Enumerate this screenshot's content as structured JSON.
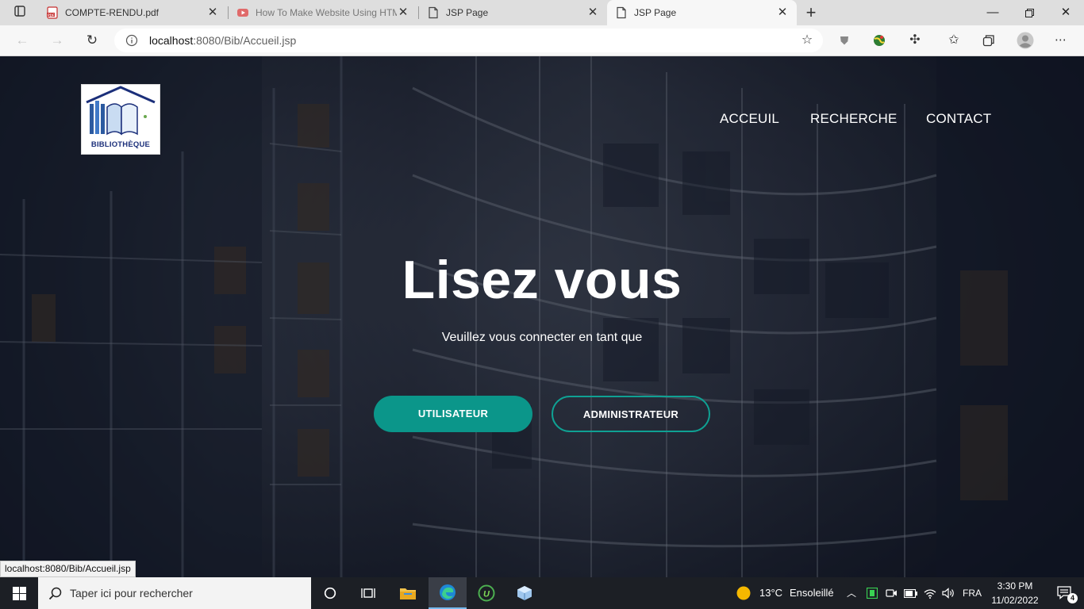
{
  "browser": {
    "tabs": [
      {
        "title": "COMPTE-RENDU.pdf",
        "icon": "pdf-icon",
        "active": false
      },
      {
        "title": "How To Make Website Using HTML",
        "icon": "youtube-icon",
        "active": false
      },
      {
        "title": "JSP Page",
        "icon": "page-icon",
        "active": false
      },
      {
        "title": "JSP Page",
        "icon": "page-icon",
        "active": true
      }
    ],
    "url_host": "localhost",
    "url_rest": ":8080/Bib/Accueil.jsp",
    "status_url": "localhost:8080/Bib/Accueil.jsp"
  },
  "site": {
    "logo_text": "BIBLIOTHÈQUE",
    "nav": [
      "ACCEUIL",
      "RECHERCHE",
      "CONTACT"
    ],
    "hero_title": "Lisez vous",
    "hero_subtitle": "Veuillez vous connecter en tant que",
    "button_user": "UTILISATEUR",
    "button_admin": "ADMINISTRATEUR",
    "accent_color": "#0b968a"
  },
  "taskbar": {
    "search_placeholder": "Taper ici pour rechercher",
    "weather_temp": "13°C",
    "weather_text": "Ensoleillé",
    "language": "FRA",
    "time": "3:30 PM",
    "date": "11/02/2022",
    "notification_count": "4"
  }
}
